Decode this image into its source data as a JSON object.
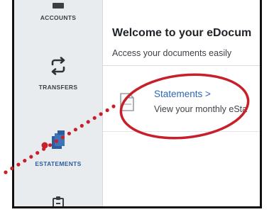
{
  "sidebar": {
    "items": [
      {
        "label": "ACCOUNTS",
        "icon": "accounts-icon"
      },
      {
        "label": "TRANSFERS",
        "icon": "transfers-icon"
      },
      {
        "label": "ESTATEMENTS",
        "icon": "estatements-icon"
      },
      {
        "label": "",
        "icon": "clipboard-icon"
      }
    ]
  },
  "main": {
    "welcome_title": "Welcome to your eDocum",
    "subtitle": "Access your documents easily",
    "statements": {
      "link_label": "Statements >",
      "description": "View your monthly eSta",
      "icon": "document-icon"
    }
  },
  "colors": {
    "sidebar_bg": "#e9ecef",
    "link": "#2d66b6",
    "annotation": "#c8202a"
  }
}
